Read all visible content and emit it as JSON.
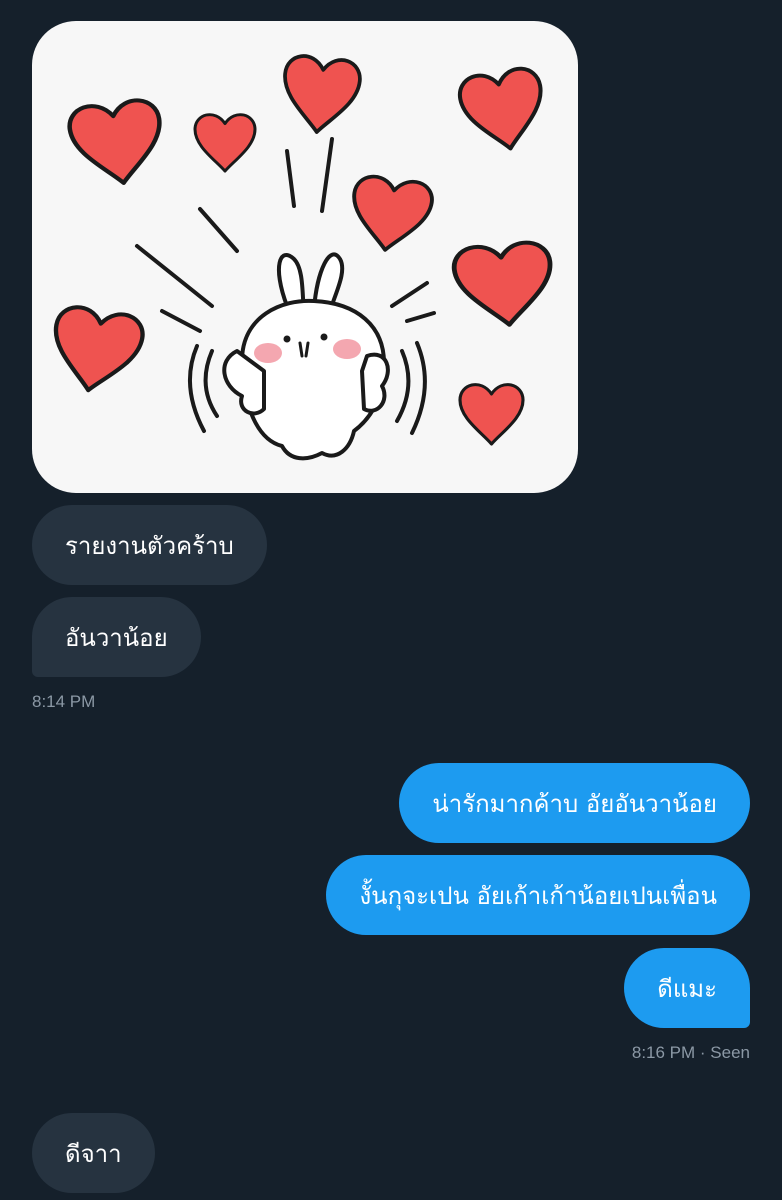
{
  "sticker": {
    "icon": "bunny-with-hearts-sticker"
  },
  "messages": [
    {
      "direction": "incoming",
      "text": "รายงานตัวคร้าบ"
    },
    {
      "direction": "incoming",
      "text": "อันวาน้อย"
    },
    {
      "direction": "outgoing",
      "text": "น่ารักมากค้าบ อัยอันวาน้อย"
    },
    {
      "direction": "outgoing",
      "text": "งั้นกุจะเปน อัยเก้าเก้าน้อยเปนเพื่อน"
    },
    {
      "direction": "outgoing",
      "text": "ดีแมะ"
    },
    {
      "direction": "incoming",
      "text": "ดีจาา"
    }
  ],
  "timestamps": {
    "incoming_group": "8:14 PM",
    "outgoing_group": "8:16 PM · Seen"
  },
  "colors": {
    "background": "#15202b",
    "incoming_bubble": "#263340",
    "outgoing_bubble": "#1d9bf0",
    "meta_text": "#8b98a5",
    "heart": "#ef5350"
  }
}
